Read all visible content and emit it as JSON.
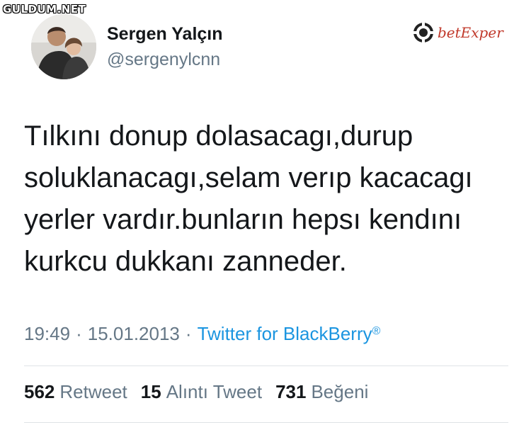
{
  "watermark": "GULDUM.NET",
  "user": {
    "name": "Sergen Yalçın",
    "handle": "@sergenylcnn"
  },
  "brand": {
    "icon": "poker-chip-icon",
    "text": "betExper",
    "color": "#c1392b"
  },
  "tweet": {
    "lines": [
      "Tılkını donup dolasacagı,durup",
      "soluklanacagı,selam verıp kacacagı",
      "yerler vardır.bunların hepsı kendını",
      "kurkcu dukkanı zanneder."
    ]
  },
  "meta": {
    "time": "19:49",
    "separator": "·",
    "date": "15.01.2013",
    "source": "Twitter for BlackBerry",
    "source_mark": "®",
    "link_color": "#1b95e0"
  },
  "stats": [
    {
      "count": "562",
      "label": "Retweet"
    },
    {
      "count": "15",
      "label": "Alıntı Tweet"
    },
    {
      "count": "731",
      "label": "Beğeni"
    }
  ]
}
